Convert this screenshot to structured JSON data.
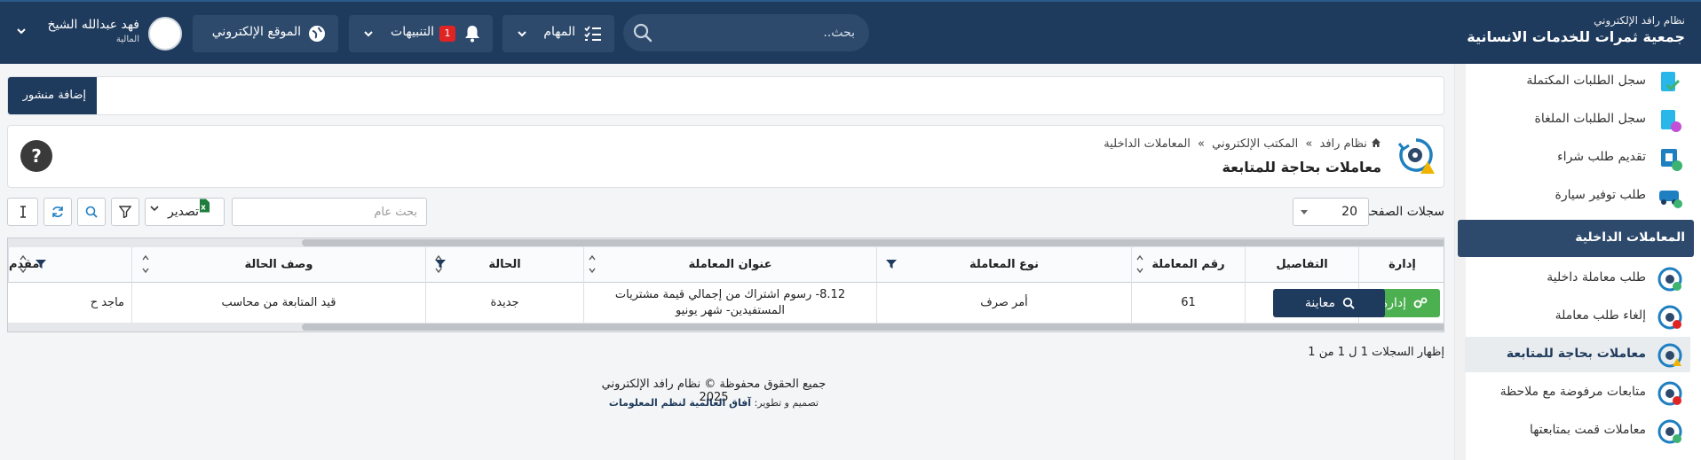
{
  "brand": {
    "system_name": "نظام رافد الإلكتروني",
    "org_name": "جمعية ثمرات للخدمات الانسانية"
  },
  "topbar": {
    "search_placeholder": "بحث..",
    "tasks_label": "المهام",
    "notifications_label": "التنبيهات",
    "notifications_count": "1",
    "website_label": "الموقع الإلكتروني",
    "user_name": "فهد عبدالله الشيخ",
    "user_role": "المالية"
  },
  "sidebar": {
    "items_top": [
      {
        "label": "سجل الطلبات المكتملة",
        "icon": "completed-requests-icon"
      },
      {
        "label": "سجل الطلبات الملغاة",
        "icon": "cancelled-requests-icon"
      },
      {
        "label": "تقديم طلب شراء",
        "icon": "purchase-request-icon"
      },
      {
        "label": "طلب توفير سيارة",
        "icon": "car-request-icon"
      }
    ],
    "section_title": "المعاملات الداخلية",
    "items_bottom": [
      {
        "label": "طلب معاملة داخلية",
        "icon": "internal-transaction-icon"
      },
      {
        "label": "إلغاء طلب معاملة",
        "icon": "cancel-transaction-icon"
      },
      {
        "label": "معاملات بحاجة للمتابعة",
        "icon": "followup-transactions-icon",
        "active": true
      },
      {
        "label": "متابعات مرفوضة مع ملاحظة",
        "icon": "rejected-followups-icon"
      },
      {
        "label": "معاملات قمت بمتابعتها",
        "icon": "followed-transactions-icon"
      }
    ]
  },
  "post_button": "إضافة منشور",
  "breadcrumb": {
    "home": "نظام رافد",
    "level2": "المكتب الإلكتروني",
    "level3": "المعاملات الداخلية",
    "separator": "»"
  },
  "page_title": "معاملات بحاجة للمتابعة",
  "help_label": "?",
  "toolbar": {
    "page_size_label": "سجلات الصفحة",
    "page_size_value": "20",
    "search_placeholder": "بحث عام",
    "export_label": "تصدير"
  },
  "table": {
    "headers": [
      "إدارة",
      "التفاصيل",
      "رقم المعاملة",
      "نوع المعاملة",
      "عنوان المعاملة",
      "الحالة",
      "وصف الحالة",
      "مقدم"
    ],
    "row": {
      "manage_label": "إدارة",
      "view_label": "معاينة",
      "number": "61",
      "type": "أمر صرف",
      "title": "8.12- رسوم اشتراك من إجمالي قيمة مشتريات المستفيدين- شهر يونيو",
      "status": "جديدة",
      "status_desc": "قيد المتابعة من محاسب",
      "submitter": "ماجد ح"
    }
  },
  "records_info": "إظهار السجلات 1 ل 1 من 1",
  "footer": {
    "copyright": "جميع الحقوق محفوظة © نظام رافد الإلكتروني 2025",
    "credit_prefix": "تصميم و تطوير:",
    "credit_company": "آفاق العالمية لنظم المعلومات"
  },
  "colors": {
    "primary": "#1e3a5c",
    "success": "#4caf50",
    "danger": "#e02424"
  }
}
